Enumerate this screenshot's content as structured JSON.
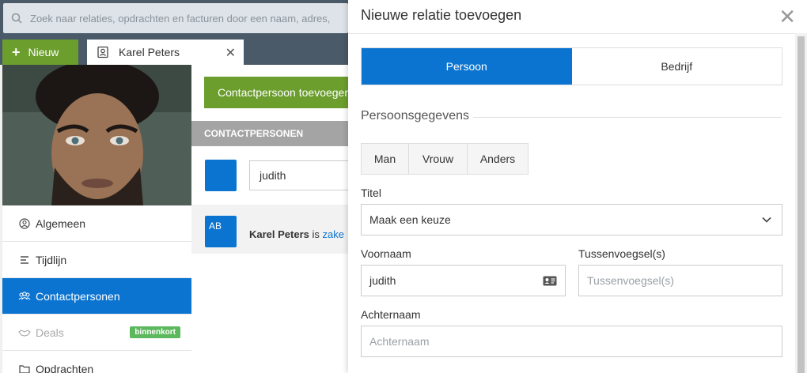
{
  "search": {
    "placeholder": "Zoek naar relaties, opdrachten en facturen door een naam, adres,"
  },
  "toolbar": {
    "new_label": "Nieuw"
  },
  "tab": {
    "label": "Karel Peters"
  },
  "sidebar": {
    "items": [
      {
        "label": "Algemeen"
      },
      {
        "label": "Tijdlijn"
      },
      {
        "label": "Contactpersonen"
      },
      {
        "label": "Deals",
        "badge": "binnenkort"
      },
      {
        "label": "Opdrachten"
      }
    ]
  },
  "main": {
    "add_contact_label": "Contactpersoon toevoegen",
    "section_title": "CONTACTPERSONEN",
    "search_value": "judith",
    "contact": {
      "initials": "AB",
      "name": "Karel Peters",
      "is": "is",
      "link": "zake"
    }
  },
  "modal": {
    "title": "Nieuwe relatie toevoegen",
    "close_symbol": "✕",
    "type_options": [
      "Persoon",
      "Bedrijf"
    ],
    "section_title": "Persoonsgegevens",
    "gender_options": [
      "Man",
      "Vrouw",
      "Anders"
    ],
    "titel_label": "Titel",
    "titel_value": "Maak een keuze",
    "voornaam_label": "Voornaam",
    "voornaam_value": "judith",
    "tussenvoegsel_label": "Tussenvoegsel(s)",
    "tussenvoegsel_placeholder": "Tussenvoegsel(s)",
    "achternaam_label": "Achternaam",
    "achternaam_placeholder": "Achternaam"
  },
  "colors": {
    "accent": "#0a74d0",
    "green": "#6c9e2e",
    "badge": "#5cb85c"
  }
}
